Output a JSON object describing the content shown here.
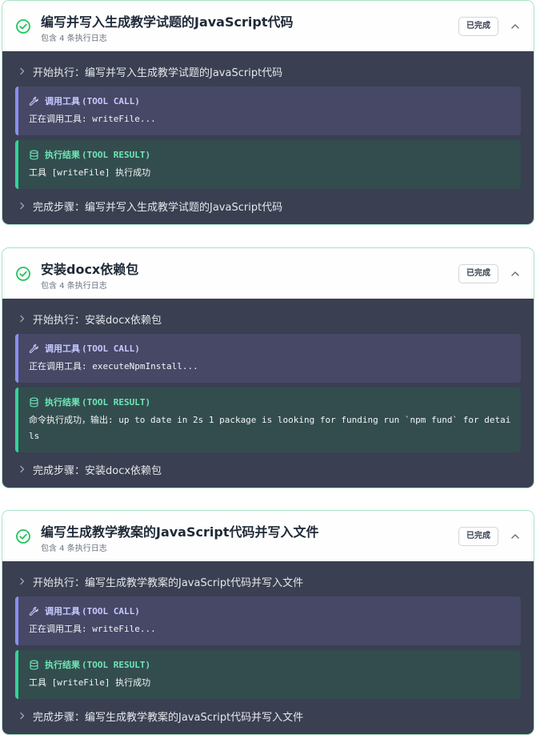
{
  "colors": {
    "accent_green": "#22c55e",
    "card_border": "#a7e3c4",
    "body_bg": "#3a3f51",
    "tool_call_bar": "#8b8ff0",
    "tool_result_bar": "#34d399"
  },
  "icons": {
    "status": "check-circle-icon",
    "toggle": "chevron-up-icon",
    "log": "chevron-right-icon",
    "tool_call": "wrench-icon",
    "tool_result": "database-icon"
  },
  "steps": [
    {
      "title": "编写并写入生成教学试题的JavaScript代码",
      "subtitle": "包含 4 条执行日志",
      "status": "已完成",
      "start_log": "开始执行：编写并写入生成教学试题的JavaScript代码",
      "tool_call": {
        "label": "调用工具",
        "tag": "(TOOL CALL)",
        "text": "正在调用工具: writeFile..."
      },
      "tool_result": {
        "label": "执行结果",
        "tag": "(TOOL RESULT)",
        "text": "工具 [writeFile] 执行成功"
      },
      "end_log": "完成步骤：编写并写入生成教学试题的JavaScript代码"
    },
    {
      "title": "安装docx依赖包",
      "subtitle": "包含 4 条执行日志",
      "status": "已完成",
      "start_log": "开始执行：安装docx依赖包",
      "tool_call": {
        "label": "调用工具",
        "tag": "(TOOL CALL)",
        "text": "正在调用工具: executeNpmInstall..."
      },
      "tool_result": {
        "label": "执行结果",
        "tag": "(TOOL RESULT)",
        "text": "命令执行成功，输出:  up to date in 2s 1 package is looking for funding run `npm fund` for details"
      },
      "end_log": "完成步骤：安装docx依赖包"
    },
    {
      "title": "编写生成教学教案的JavaScript代码并写入文件",
      "subtitle": "包含 4 条执行日志",
      "status": "已完成",
      "start_log": "开始执行：编写生成教学教案的JavaScript代码并写入文件",
      "tool_call": {
        "label": "调用工具",
        "tag": "(TOOL CALL)",
        "text": "正在调用工具: writeFile..."
      },
      "tool_result": {
        "label": "执行结果",
        "tag": "(TOOL RESULT)",
        "text": "工具 [writeFile] 执行成功"
      },
      "end_log": "完成步骤：编写生成教学教案的JavaScript代码并写入文件"
    }
  ]
}
